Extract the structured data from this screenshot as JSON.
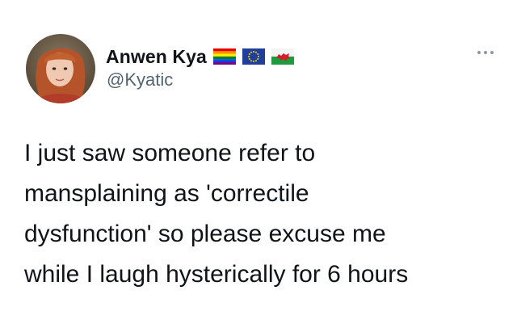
{
  "author": {
    "display_name": "Anwen Kya",
    "handle": "@Kyatic",
    "avatar_icon": "profile-photo",
    "badges": [
      "rainbow-flag-icon",
      "eu-flag-icon",
      "welsh-flag-icon"
    ]
  },
  "menu": {
    "icon": "more-options-icon"
  },
  "tweet": {
    "lines": [
      "I just saw someone refer to",
      "mansplaining as 'correctile",
      "dysfunction' so please excuse me",
      "while I laugh hysterically for 6 hours"
    ]
  },
  "colors": {
    "text": "#0f1419",
    "secondary": "#536471",
    "background": "#ffffff"
  }
}
